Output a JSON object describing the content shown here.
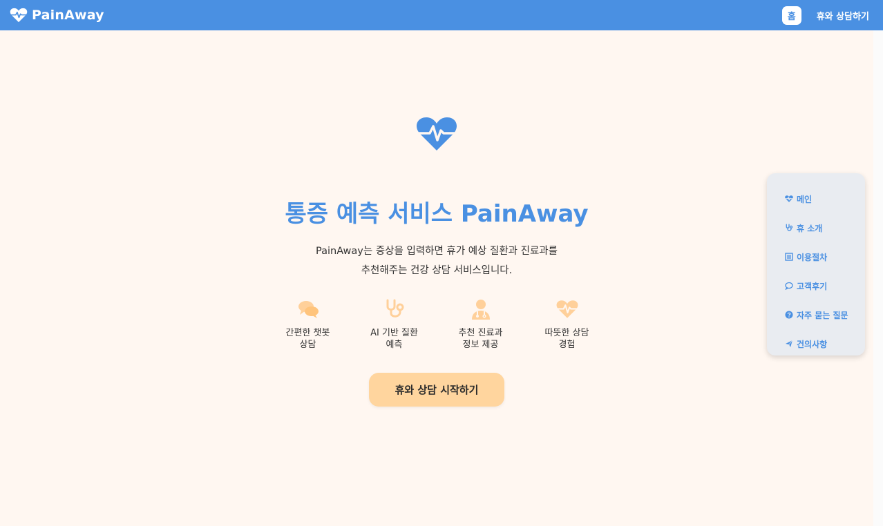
{
  "header": {
    "brand_name": "PainAway",
    "brand_icon": "heart-pulse-icon",
    "nav_home": "홈",
    "nav_consult": "휴와 상담하기"
  },
  "hero": {
    "icon": "heart-pulse-icon",
    "title": "통증 예측 서비스 PainAway",
    "description_line1": "PainAway는 증상을 입력하면 휴가 예상 질환과 진료과를",
    "description_line2": "추천해주는 건강 상담 서비스입니다.",
    "features": [
      {
        "icon": "chat-bubbles-icon",
        "label": "간편한 챗봇\n상담"
      },
      {
        "icon": "stethoscope-icon",
        "label": "AI 기반 질환\n예측"
      },
      {
        "icon": "doctor-icon",
        "label": "추천 진료과\n정보 제공"
      },
      {
        "icon": "heart-pulse-icon",
        "label": "따뜻한 상담\n경험"
      }
    ],
    "cta_label": "휴와 상담 시작하기"
  },
  "side_menu": {
    "items": [
      {
        "icon": "heart-pulse-icon",
        "label": "메인"
      },
      {
        "icon": "stethoscope-icon",
        "label": "휴 소개"
      },
      {
        "icon": "list-icon",
        "label": "이용절차"
      },
      {
        "icon": "comment-icon",
        "label": "고객후기"
      },
      {
        "icon": "question-circle-icon",
        "label": "자주 묻는 질문"
      },
      {
        "icon": "paper-plane-icon",
        "label": "건의사항"
      }
    ]
  },
  "colors": {
    "primary": "#4a90e2",
    "accent": "#ffd59e",
    "background": "#fff7f1",
    "icon_peach": "#ffd09a"
  }
}
